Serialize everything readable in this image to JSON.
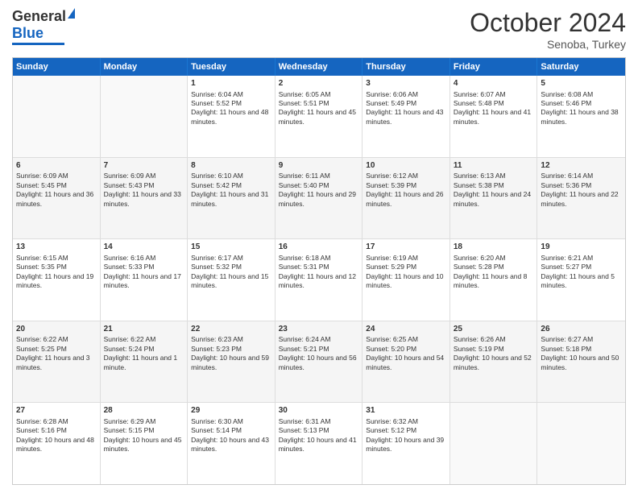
{
  "header": {
    "logo_general": "General",
    "logo_blue": "Blue",
    "month_title": "October 2024",
    "location": "Senoba, Turkey"
  },
  "weekdays": [
    "Sunday",
    "Monday",
    "Tuesday",
    "Wednesday",
    "Thursday",
    "Friday",
    "Saturday"
  ],
  "rows": [
    [
      {
        "day": "",
        "sunrise": "",
        "sunset": "",
        "daylight": "",
        "empty": true
      },
      {
        "day": "",
        "sunrise": "",
        "sunset": "",
        "daylight": "",
        "empty": true
      },
      {
        "day": "1",
        "sunrise": "Sunrise: 6:04 AM",
        "sunset": "Sunset: 5:52 PM",
        "daylight": "Daylight: 11 hours and 48 minutes.",
        "empty": false
      },
      {
        "day": "2",
        "sunrise": "Sunrise: 6:05 AM",
        "sunset": "Sunset: 5:51 PM",
        "daylight": "Daylight: 11 hours and 45 minutes.",
        "empty": false
      },
      {
        "day": "3",
        "sunrise": "Sunrise: 6:06 AM",
        "sunset": "Sunset: 5:49 PM",
        "daylight": "Daylight: 11 hours and 43 minutes.",
        "empty": false
      },
      {
        "day": "4",
        "sunrise": "Sunrise: 6:07 AM",
        "sunset": "Sunset: 5:48 PM",
        "daylight": "Daylight: 11 hours and 41 minutes.",
        "empty": false
      },
      {
        "day": "5",
        "sunrise": "Sunrise: 6:08 AM",
        "sunset": "Sunset: 5:46 PM",
        "daylight": "Daylight: 11 hours and 38 minutes.",
        "empty": false
      }
    ],
    [
      {
        "day": "6",
        "sunrise": "Sunrise: 6:09 AM",
        "sunset": "Sunset: 5:45 PM",
        "daylight": "Daylight: 11 hours and 36 minutes.",
        "empty": false
      },
      {
        "day": "7",
        "sunrise": "Sunrise: 6:09 AM",
        "sunset": "Sunset: 5:43 PM",
        "daylight": "Daylight: 11 hours and 33 minutes.",
        "empty": false
      },
      {
        "day": "8",
        "sunrise": "Sunrise: 6:10 AM",
        "sunset": "Sunset: 5:42 PM",
        "daylight": "Daylight: 11 hours and 31 minutes.",
        "empty": false
      },
      {
        "day": "9",
        "sunrise": "Sunrise: 6:11 AM",
        "sunset": "Sunset: 5:40 PM",
        "daylight": "Daylight: 11 hours and 29 minutes.",
        "empty": false
      },
      {
        "day": "10",
        "sunrise": "Sunrise: 6:12 AM",
        "sunset": "Sunset: 5:39 PM",
        "daylight": "Daylight: 11 hours and 26 minutes.",
        "empty": false
      },
      {
        "day": "11",
        "sunrise": "Sunrise: 6:13 AM",
        "sunset": "Sunset: 5:38 PM",
        "daylight": "Daylight: 11 hours and 24 minutes.",
        "empty": false
      },
      {
        "day": "12",
        "sunrise": "Sunrise: 6:14 AM",
        "sunset": "Sunset: 5:36 PM",
        "daylight": "Daylight: 11 hours and 22 minutes.",
        "empty": false
      }
    ],
    [
      {
        "day": "13",
        "sunrise": "Sunrise: 6:15 AM",
        "sunset": "Sunset: 5:35 PM",
        "daylight": "Daylight: 11 hours and 19 minutes.",
        "empty": false
      },
      {
        "day": "14",
        "sunrise": "Sunrise: 6:16 AM",
        "sunset": "Sunset: 5:33 PM",
        "daylight": "Daylight: 11 hours and 17 minutes.",
        "empty": false
      },
      {
        "day": "15",
        "sunrise": "Sunrise: 6:17 AM",
        "sunset": "Sunset: 5:32 PM",
        "daylight": "Daylight: 11 hours and 15 minutes.",
        "empty": false
      },
      {
        "day": "16",
        "sunrise": "Sunrise: 6:18 AM",
        "sunset": "Sunset: 5:31 PM",
        "daylight": "Daylight: 11 hours and 12 minutes.",
        "empty": false
      },
      {
        "day": "17",
        "sunrise": "Sunrise: 6:19 AM",
        "sunset": "Sunset: 5:29 PM",
        "daylight": "Daylight: 11 hours and 10 minutes.",
        "empty": false
      },
      {
        "day": "18",
        "sunrise": "Sunrise: 6:20 AM",
        "sunset": "Sunset: 5:28 PM",
        "daylight": "Daylight: 11 hours and 8 minutes.",
        "empty": false
      },
      {
        "day": "19",
        "sunrise": "Sunrise: 6:21 AM",
        "sunset": "Sunset: 5:27 PM",
        "daylight": "Daylight: 11 hours and 5 minutes.",
        "empty": false
      }
    ],
    [
      {
        "day": "20",
        "sunrise": "Sunrise: 6:22 AM",
        "sunset": "Sunset: 5:25 PM",
        "daylight": "Daylight: 11 hours and 3 minutes.",
        "empty": false
      },
      {
        "day": "21",
        "sunrise": "Sunrise: 6:22 AM",
        "sunset": "Sunset: 5:24 PM",
        "daylight": "Daylight: 11 hours and 1 minute.",
        "empty": false
      },
      {
        "day": "22",
        "sunrise": "Sunrise: 6:23 AM",
        "sunset": "Sunset: 5:23 PM",
        "daylight": "Daylight: 10 hours and 59 minutes.",
        "empty": false
      },
      {
        "day": "23",
        "sunrise": "Sunrise: 6:24 AM",
        "sunset": "Sunset: 5:21 PM",
        "daylight": "Daylight: 10 hours and 56 minutes.",
        "empty": false
      },
      {
        "day": "24",
        "sunrise": "Sunrise: 6:25 AM",
        "sunset": "Sunset: 5:20 PM",
        "daylight": "Daylight: 10 hours and 54 minutes.",
        "empty": false
      },
      {
        "day": "25",
        "sunrise": "Sunrise: 6:26 AM",
        "sunset": "Sunset: 5:19 PM",
        "daylight": "Daylight: 10 hours and 52 minutes.",
        "empty": false
      },
      {
        "day": "26",
        "sunrise": "Sunrise: 6:27 AM",
        "sunset": "Sunset: 5:18 PM",
        "daylight": "Daylight: 10 hours and 50 minutes.",
        "empty": false
      }
    ],
    [
      {
        "day": "27",
        "sunrise": "Sunrise: 6:28 AM",
        "sunset": "Sunset: 5:16 PM",
        "daylight": "Daylight: 10 hours and 48 minutes.",
        "empty": false
      },
      {
        "day": "28",
        "sunrise": "Sunrise: 6:29 AM",
        "sunset": "Sunset: 5:15 PM",
        "daylight": "Daylight: 10 hours and 45 minutes.",
        "empty": false
      },
      {
        "day": "29",
        "sunrise": "Sunrise: 6:30 AM",
        "sunset": "Sunset: 5:14 PM",
        "daylight": "Daylight: 10 hours and 43 minutes.",
        "empty": false
      },
      {
        "day": "30",
        "sunrise": "Sunrise: 6:31 AM",
        "sunset": "Sunset: 5:13 PM",
        "daylight": "Daylight: 10 hours and 41 minutes.",
        "empty": false
      },
      {
        "day": "31",
        "sunrise": "Sunrise: 6:32 AM",
        "sunset": "Sunset: 5:12 PM",
        "daylight": "Daylight: 10 hours and 39 minutes.",
        "empty": false
      },
      {
        "day": "",
        "sunrise": "",
        "sunset": "",
        "daylight": "",
        "empty": true
      },
      {
        "day": "",
        "sunrise": "",
        "sunset": "",
        "daylight": "",
        "empty": true
      }
    ]
  ]
}
